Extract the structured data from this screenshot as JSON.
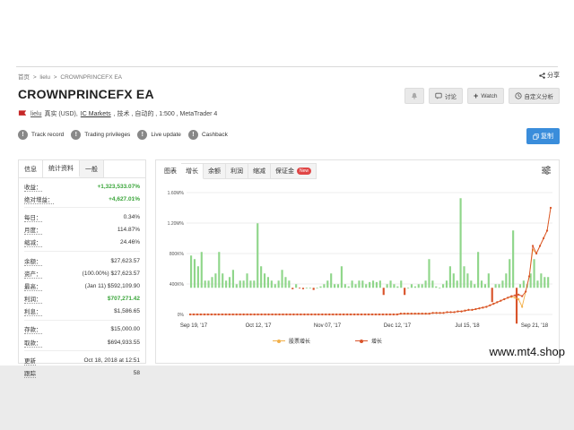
{
  "breadcrumb": [
    "首页",
    "lielu",
    "CROWNPRINCEFX EA"
  ],
  "breadcrumb_sep": ">",
  "share_label": "分享",
  "title": "CROWNPRINCEFX EA",
  "header_buttons": {
    "discuss": "讨论",
    "watch": "Watch",
    "custom_analysis": "自定义分析"
  },
  "subline": {
    "owner": "lielu",
    "account": "真实 (USD),",
    "broker": "IC Markets",
    "rest": ", 技术 , 自动的 , 1:500 , MetaTrader 4"
  },
  "badges": [
    "Track record",
    "Trading privileges",
    "Live update",
    "Cashback"
  ],
  "copy_button": "复制",
  "left_tabs": [
    "信息",
    "统计资料",
    "一般"
  ],
  "stats": [
    {
      "k": "收益：",
      "v": "+1,323,533.07%",
      "green": true
    },
    {
      "k": "绝对增益：",
      "v": "+4,627.01%",
      "green": true
    },
    {
      "k": "每日：",
      "v": "0.34%"
    },
    {
      "k": "月度：",
      "v": "114.87%"
    },
    {
      "k": "缩减：",
      "v": "24.46%"
    },
    {
      "k": "余额：",
      "v": "$27,623.57"
    },
    {
      "k": "资产：",
      "v": "(100.00%) $27,623.57"
    },
    {
      "k": "最高：",
      "v": "(Jan 11) $592,109.90"
    },
    {
      "k": "利润：",
      "v": "$707,271.42",
      "green": true
    },
    {
      "k": "利息：",
      "v": "$1,586.65"
    },
    {
      "k": "存款：",
      "v": "$15,000.00"
    },
    {
      "k": "取款：",
      "v": "$694,933.55"
    },
    {
      "k": "更新",
      "v": "Oct 18, 2018 at 12:51"
    },
    {
      "k": "跟踪",
      "v": "58"
    }
  ],
  "right_tabs": [
    "图表",
    "增长",
    "余额",
    "利润",
    "缩减",
    "保证金"
  ],
  "new_badge": "New",
  "chart_data": {
    "type": "bar",
    "yticks": [
      "1.60M%",
      "1.20M%",
      "800K%",
      "400K%",
      "0%"
    ],
    "xticks": [
      "Sep 19, '17",
      "Oct 12, '17",
      "Nov 07, '17",
      "Dec 12, '17",
      "Jul 15, '18",
      "Sep 21, '18"
    ],
    "bar_values": [
      0.45,
      0.4,
      0.3,
      0.5,
      0.1,
      0.1,
      0.15,
      0.2,
      0.5,
      0.2,
      0.1,
      0.15,
      0.25,
      0.05,
      0.1,
      0.1,
      0.2,
      0.1,
      0.1,
      0.9,
      0.3,
      0.2,
      0.15,
      0.1,
      0.05,
      0.1,
      0.25,
      0.15,
      0.1,
      -0.02,
      0.05,
      -0.01,
      -0.02,
      0.0,
      0.0,
      -0.03,
      0.0,
      0.02,
      0.05,
      0.1,
      0.2,
      0.05,
      0.05,
      0.3,
      0.05,
      0.02,
      0.1,
      0.05,
      0.1,
      0.1,
      0.05,
      0.08,
      0.1,
      0.08,
      0.1,
      -0.1,
      0.05,
      0.1,
      0.05,
      0.02,
      0.1,
      -0.1,
      0.0,
      0.05,
      0.02,
      0.05,
      0.05,
      0.1,
      0.4,
      0.1,
      0.02,
      0.0,
      0.05,
      0.1,
      0.3,
      0.2,
      0.1,
      1.25,
      0.3,
      0.2,
      0.1,
      0.05,
      0.5,
      0.1,
      0.05,
      0.2,
      -0.2,
      0.05,
      0.05,
      0.1,
      0.2,
      0.4,
      0.8,
      -0.5,
      0.05,
      0.1,
      0.05,
      0.2,
      0.4,
      0.1,
      0.2,
      0.15,
      0.15
    ],
    "line_growth": [
      0.0,
      0.0,
      0.0,
      0.0,
      0.0,
      0.0,
      0.0,
      0.0,
      0.0,
      0.0,
      0.0,
      0.0,
      0.0,
      0.0,
      0.0,
      0.0,
      0.0,
      0.0,
      0.0,
      0.0,
      0.0,
      0.0,
      0.0,
      0.0,
      0.0,
      0.0,
      0.0,
      0.0,
      0.0,
      0.0,
      0.0,
      0.0,
      0.0,
      0.0,
      0.0,
      0.0,
      0.0,
      0.0,
      0.0,
      0.0,
      0.0,
      0.0,
      0.0,
      0.0,
      0.0,
      0.0,
      0.0,
      0.0,
      0.0,
      0.0,
      0.0,
      0.0,
      0.0,
      0.0,
      0.0,
      0.0,
      0.0,
      0.0,
      0.0,
      0.01,
      0.01,
      0.01,
      0.01,
      0.01,
      0.01,
      0.01,
      0.01,
      0.01,
      0.02,
      0.02,
      0.02,
      0.02,
      0.03,
      0.03,
      0.03,
      0.04,
      0.04,
      0.05,
      0.06,
      0.06,
      0.07,
      0.08,
      0.09,
      0.1,
      0.12,
      0.14,
      0.16,
      0.18,
      0.2,
      0.22,
      0.24,
      0.25,
      0.26,
      0.24,
      0.3,
      0.5,
      0.9,
      0.8,
      0.9,
      1.0,
      1.1,
      1.4
    ],
    "line_equity": [
      0.0,
      0.0,
      0.0,
      0.0,
      0.0,
      0.0,
      0.0,
      0.0,
      0.0,
      0.0,
      0.0,
      0.0,
      0.0,
      0.0,
      0.0,
      0.0,
      0.0,
      0.0,
      0.0,
      0.0,
      0.0,
      0.0,
      0.0,
      0.0,
      0.0,
      0.0,
      0.0,
      0.0,
      0.0,
      0.0,
      0.0,
      0.0,
      0.0,
      0.0,
      0.0,
      0.0,
      0.0,
      0.0,
      0.0,
      0.0,
      0.0,
      0.0,
      0.0,
      0.0,
      0.0,
      0.0,
      0.0,
      0.0,
      0.0,
      0.0,
      0.0,
      0.0,
      0.0,
      0.0,
      0.0,
      0.0,
      0.0,
      0.0,
      0.0,
      0.01,
      0.01,
      0.01,
      0.01,
      0.01,
      0.01,
      0.01,
      0.01,
      0.01,
      0.02,
      0.02,
      0.02,
      0.02,
      0.03,
      0.03,
      0.03,
      0.04,
      0.04,
      0.05,
      0.06,
      0.06,
      0.07,
      0.08,
      0.09,
      0.1,
      0.12,
      0.14,
      0.16,
      0.18,
      0.2,
      0.22,
      0.23,
      0.22,
      0.2,
      0.1,
      0.3,
      0.5,
      0.85,
      0.8,
      0.9,
      1.0,
      1.1,
      1.4
    ],
    "series": [
      {
        "name": "股票增长",
        "color": "#f2b04a"
      },
      {
        "name": "增长",
        "color": "#d9542b"
      }
    ],
    "bar_color": "#8fd68a",
    "bar_neg_color": "#d9542b"
  },
  "watermark": "www.mt4.shop"
}
